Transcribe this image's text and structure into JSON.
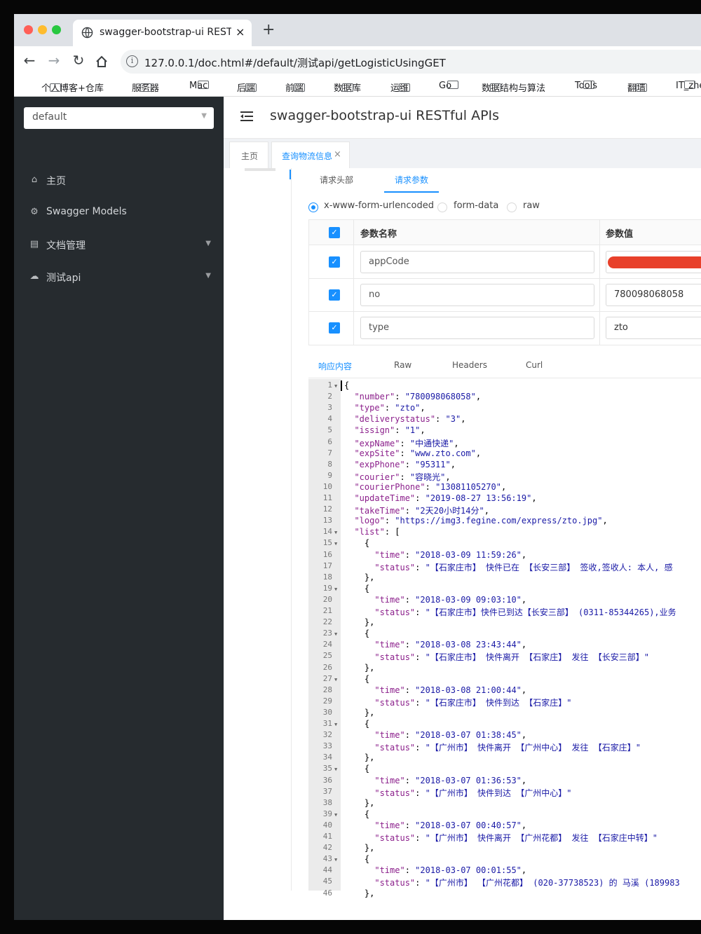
{
  "colors": {
    "accent": "#1890ff",
    "sidebar_bg": "#262b2f",
    "redacted": "#e8402a",
    "close_light": "#ff5f57",
    "min_light": "#febc2e",
    "max_light": "#28c840"
  },
  "browser": {
    "tab_title": "swagger-bootstrap-ui RESTful APIs",
    "tab_close": "×",
    "new_tab": "+",
    "url": "127.0.0.1/doc.html#/default/测试api/getLogisticUsingGET",
    "bookmarks": [
      "个人博客+仓库",
      "服务器",
      "Mac",
      "后端",
      "前端",
      "数据库",
      "运维",
      "Go",
      "数据结构与算法",
      "Tools",
      "翻墙",
      "IT_zhe"
    ]
  },
  "sidebar": {
    "group": "default",
    "items": [
      {
        "label": "主页",
        "icon": "home-icon"
      },
      {
        "label": "Swagger Models",
        "icon": "models-icon"
      },
      {
        "label": "文档管理",
        "icon": "doc-manage-icon",
        "expandable": true
      },
      {
        "label": "测试api",
        "icon": "cloud-icon",
        "expandable": true
      }
    ]
  },
  "header": {
    "title": "swagger-bootstrap-ui RESTful APIs"
  },
  "page_tabs": {
    "home": "主页",
    "active": "查询物流信息",
    "close": "×"
  },
  "request": {
    "tabs": [
      "请求头部",
      "请求参数"
    ],
    "active_tab": "请求参数",
    "content_types": [
      "x-www-form-urlencoded",
      "form-data",
      "raw"
    ],
    "selected_content_type": "x-www-form-urlencoded",
    "columns": [
      "参数名称",
      "参数值"
    ],
    "params": [
      {
        "name": "appCode",
        "value": "",
        "redacted": true
      },
      {
        "name": "no",
        "value": "780098068058"
      },
      {
        "name": "type",
        "value": "zto"
      }
    ]
  },
  "response": {
    "tabs": [
      "响应内容",
      "Raw",
      "Headers",
      "Curl"
    ],
    "active_tab": "响应内容",
    "lines": [
      "{",
      "  \"number\": \"780098068058\",",
      "  \"type\": \"zto\",",
      "  \"deliverystatus\": \"3\",",
      "  \"issign\": \"1\",",
      "  \"expName\": \"中通快递\",",
      "  \"expSite\": \"www.zto.com\",",
      "  \"expPhone\": \"95311\",",
      "  \"courier\": \"容晓光\",",
      "  \"courierPhone\": \"13081105270\",",
      "  \"updateTime\": \"2019-08-27 13:56:19\",",
      "  \"takeTime\": \"2天20小时14分\",",
      "  \"logo\": \"https://img3.fegine.com/express/zto.jpg\",",
      "  \"list\": [",
      "    {",
      "      \"time\": \"2018-03-09 11:59:26\",",
      "      \"status\": \"【石家庄市】 快件已在 【长安三部】 签收,签收人: 本人, 感",
      "    },",
      "    {",
      "      \"time\": \"2018-03-09 09:03:10\",",
      "      \"status\": \"【石家庄市】快件已到达【长安三部】 (0311-85344265),业务",
      "    },",
      "    {",
      "      \"time\": \"2018-03-08 23:43:44\",",
      "      \"status\": \"【石家庄市】 快件离开 【石家庄】 发往 【长安三部】\"",
      "    },",
      "    {",
      "      \"time\": \"2018-03-08 21:00:44\",",
      "      \"status\": \"【石家庄市】 快件到达 【石家庄】\"",
      "    },",
      "    {",
      "      \"time\": \"2018-03-07 01:38:45\",",
      "      \"status\": \"【广州市】 快件离开 【广州中心】 发往 【石家庄】\"",
      "    },",
      "    {",
      "      \"time\": \"2018-03-07 01:36:53\",",
      "      \"status\": \"【广州市】 快件到达 【广州中心】\"",
      "    },",
      "    {",
      "      \"time\": \"2018-03-07 00:40:57\",",
      "      \"status\": \"【广州市】 快件离开 【广州花都】 发往 【石家庄中转】\"",
      "    },",
      "    {",
      "      \"time\": \"2018-03-07 00:01:55\",",
      "      \"status\": \"【广州市】 【广州花都】 (020-37738523) 的 马溪 (189983",
      "    },"
    ]
  }
}
